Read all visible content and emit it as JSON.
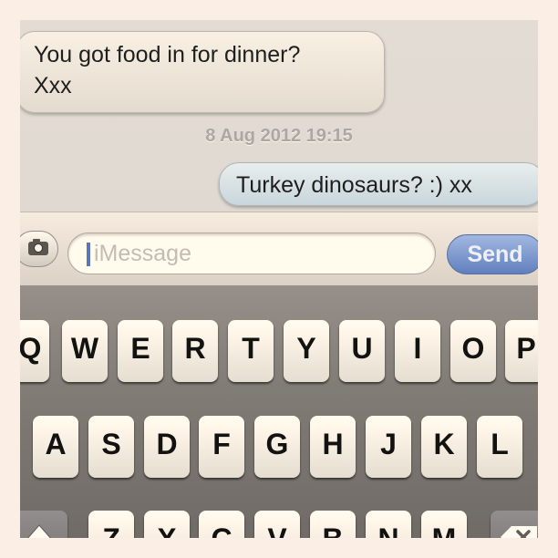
{
  "conversation": {
    "incoming_line1": "You got food in for dinner?",
    "incoming_line2": "Xxx",
    "timestamp": "8 Aug 2012 19:15",
    "outgoing": "Turkey dinosaurs? :) xx"
  },
  "input_bar": {
    "camera_icon": "camera-icon",
    "placeholder": "iMessage",
    "send_label": "Send",
    "send_color": "#5b86db"
  },
  "keyboard": {
    "row1": [
      "Q",
      "W",
      "E",
      "R",
      "T",
      "Y",
      "U",
      "I",
      "O",
      "P"
    ],
    "row2": [
      "A",
      "S",
      "D",
      "F",
      "G",
      "H",
      "J",
      "K",
      "L"
    ],
    "row3": [
      "Z",
      "X",
      "C",
      "V",
      "B",
      "N",
      "M"
    ],
    "shift_icon": "shift-arrow-icon",
    "delete_icon": "backspace-icon"
  }
}
